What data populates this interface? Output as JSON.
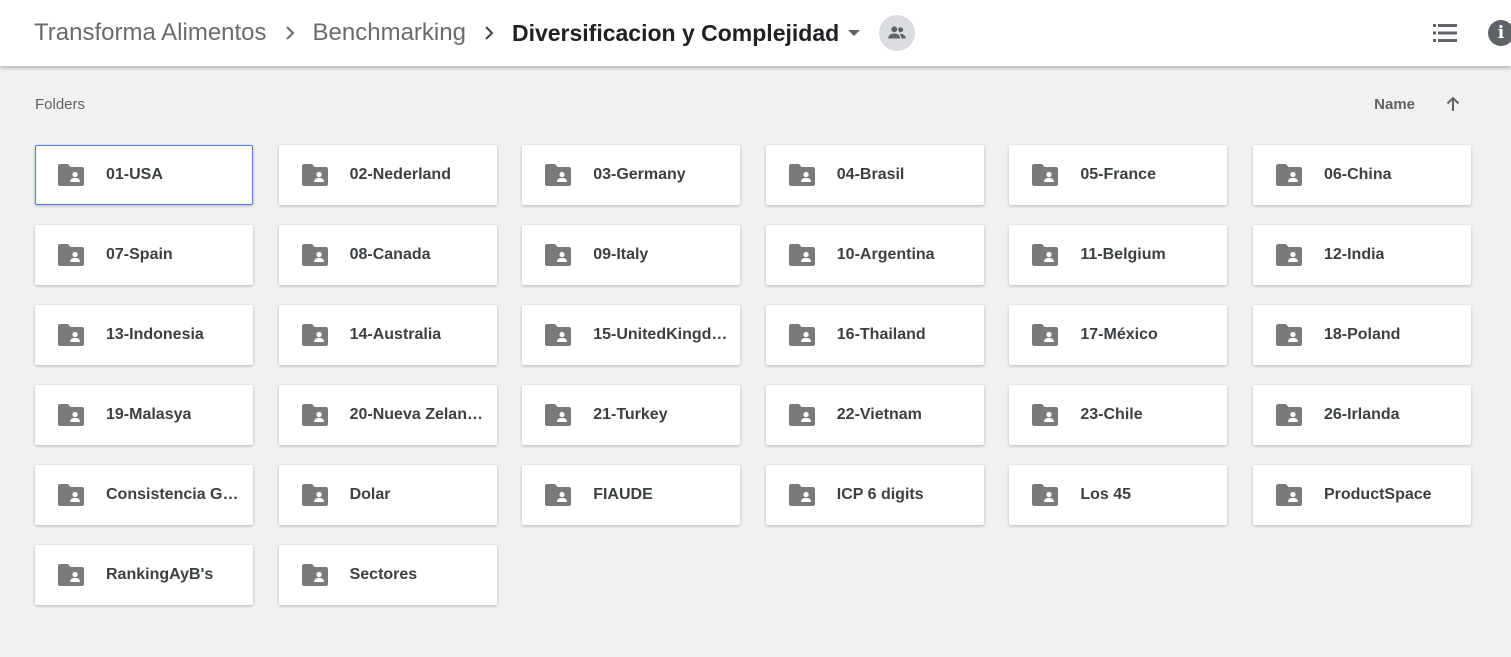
{
  "breadcrumb": {
    "items": [
      "Transforma Alimentos",
      "Benchmarking"
    ],
    "current": "Diversificacion y Complejidad"
  },
  "toolbar": {
    "shared_icon": "people-icon",
    "list_view_icon": "list-view-icon",
    "info_icon": "info-icon",
    "info_glyph": "i"
  },
  "section": {
    "label": "Folders",
    "sort_label": "Name",
    "sort_direction": "ascending"
  },
  "folders": [
    {
      "name": "01-USA",
      "selected": true
    },
    {
      "name": "02-Nederland"
    },
    {
      "name": "03-Germany"
    },
    {
      "name": "04-Brasil"
    },
    {
      "name": "05-France"
    },
    {
      "name": "06-China"
    },
    {
      "name": "07-Spain"
    },
    {
      "name": "08-Canada"
    },
    {
      "name": "09-Italy"
    },
    {
      "name": "10-Argentina"
    },
    {
      "name": "11-Belgium"
    },
    {
      "name": "12-India"
    },
    {
      "name": "13-Indonesia"
    },
    {
      "name": "14-Australia"
    },
    {
      "name": "15-UnitedKingdo…"
    },
    {
      "name": "16-Thailand"
    },
    {
      "name": "17-México"
    },
    {
      "name": "18-Poland"
    },
    {
      "name": "19-Malasya"
    },
    {
      "name": "20-Nueva Zelan…"
    },
    {
      "name": "21-Turkey"
    },
    {
      "name": "22-Vietnam"
    },
    {
      "name": "23-Chile"
    },
    {
      "name": "26-Irlanda"
    },
    {
      "name": "Consistencia Gl…"
    },
    {
      "name": "Dolar"
    },
    {
      "name": "FIAUDE"
    },
    {
      "name": "ICP 6 digits"
    },
    {
      "name": "Los 45"
    },
    {
      "name": "ProductSpace"
    },
    {
      "name": "RankingAyB's"
    },
    {
      "name": "Sectores"
    }
  ],
  "colors": {
    "background": "#f1f1f1",
    "icon": "#7a7a7a",
    "selected_border": "#4d7fd6"
  }
}
